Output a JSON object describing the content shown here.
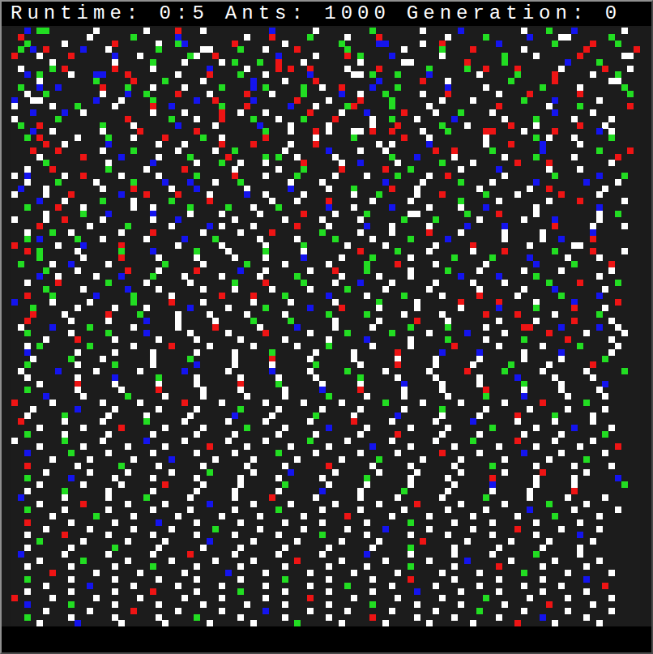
{
  "status_bar": {
    "runtime": "Runtime: 0:5",
    "ants": "Ants: 1000",
    "generation": "Generation: 0"
  },
  "grid": {
    "legend": {
      "w": "#ffffff",
      "r": "#ee1414",
      "g": "#22dd22",
      "b": "#1414ee"
    },
    "rows": [
      "..b.gg.......w.......w....r...w..........b......w........g.......w.....b.........w...g...b.......w..",
      ".r..........w......g......b..........w...r.....g.....w....r..........w.....g......b....ww......g....",
      "..g.....w.......r......w..gb.......r.......w........g.....bb.....w..r........b........g.....r...g...",
      ".g.b.r.....b...w.......g......ww....g...w....r.......g........w.....g....r.......w.........r.......r",
      "r...w....r......b...w.......gw..r.........b.....w....r.g....b.......w.........g....w......r......ww.",
      "......w.........w.....g....w.....w.g...g..r...w........w......ww........r.....g.........b....g......",
      ".w....g.r.......r.....w........b.....w....r.r..r.....w....r.......g.....g..r....r......w......r...w.",
      "..b.g....w...bb...r.......w....r....g...w......b......ww.g...g....b.......w.....g.....r.....w...g...",
      "....w........g.....r....g.....w.......b....w....r.........b......r...w.........g......r........ww...",
      ".g..b..b......r...g...w....w.....g....b.g.....g..w..r....b...g.......b.....w........g.....w......g..",
      "..w..g........w...b..g....r....w.....r...w....g.....b..w...g.....w...r.......w....r.......r.......g.",
      "b..ww........b...w....g......b..r.....b......r....w....r....g.......w....w.......g....b......w......",
      "w.....w...g.....w.....r..b.......g...r......b...w....gr.....g.....w..........r.......w....g.......r.",
      "...b....b..w..........w....w.....r..w...w......r....w...b.....r....w...g....w.........b.....w.......",
      "w......g..........r......g...w...r....g...w...g....r.....w..g...w.....b.......w....g.....w.....w....",
      ".g..r.........g....w......b.....w......b....w.....w......w...r......g...w......r...w......r...w.....",
      "...b..w.......w.....r........r..........g...w...r.w...ww.r..r....w...g.....rr....w....r......b.w....",
      "..g.r.....w....g...w....r.....g..w......r.......w.....g.......r...w........w.......g.w...w.....g....",
      ".....r..w......b.......w...w.....r....r.....w...r.........w.w.....b........w...r....b.....w.........",
      "...r...r......w....g......w.....w..g.......w......b....w...w.......r..r.....g.......b........g....r.",
      "....w......r.....b.....w....g.....r.....g.g..w.....w........g...b.....w.......w....g.....w......r...",
      ".....g.........w......b......w...g..w...w.....r.....w..b.....w......g....w......r....r.........w....",
      "..w...r........g.....w.....r.......w......w...g.....r......r...g.......w.....b.......w....w.........",
      "w.b.....w..r.....w.....w.....g.....r....w....g.....w....w....g....w..r........w.......g......b...g..",
      "..w....g.....w.....g....b...b...w...g.......w....w.........b.....w.....g....w......b.......b....w...",
      ".b...w........w....r.....w...b.......w......b.....w...g.....r...w.........w.......w..r........w.....",
      "w....w...r.......b...r....r....w.....b..w.....w.......w...g.....w...r......g....w......r.....w......",
      "....b...w.....g....w.....g.....r.........w...w....r......w.....w.......g.....w.......w....r......w..",
      "..g....r...w.......w..w.....g.....g...w...g.......b...w.....b.....w....w...b.......w.........b......",
      ".....w.....g...b......b.....w....w.....w......r....w....g......ww.......g....r.....w.........w..g...",
      "w....w..r.....w.......w...b........w.......w.....w.....w......g....g......w......w....b......w......",
      "....r.......w.....g......w.....b.w....w......r....w.....b...w.....w.....b.....b.......r.....w....w..",
      "..w...g..w.......w....r.......w.....w....r.......g.....w....w.....r....w......w.....w.......b.......",
      "..g.b.....g...w......w.....b....g......w.....w.....g.....w.....g.....b........w.....w..b....r.......",
      "r......w...b.....r........w......w......w.....g......w.....w.......w.....r........w......ww.........",
      "..r.g.....w......g....b......g....w.....g.....w........r.....g....w......w....r.......g.....r....w..",
      "....g......w.....r.....w.....w.....w....w.....b.....w....g.....w......g.....g.....b.....w....w......",
      ".g....w..b.....w........g.....w......g.....w......w.....g....r.....w.......w.......b.....g.....r....",
      ".....g....w.......r....w.....r......b...w......w...r....g......w.....g....w......w.....w.......w....",
      "....b..w.....w...b....g....w.....w.....w.....g......w.....w....w.......b.....b.....g.........w......",
      "..w....r.......g.....w......w......g....r.....g....w...b....w......w.....w....w......g....r.....g...",
      ".....g.....w......b....w......w....w.....w.....w.....g.....w......w.......w......w....b.......w.....",
      "..r...g......b.....g.....w.......r....r....g......b.....w.....g.....w.....r.....w......g.....b......",
      "b.....w.....w......g.....r....w.......w.....w......w......g.....w......r.....r.....w.....b......r...",
      "...g......w.....w....w......b.....w.....g......b....r.....w.....w......w.....b.....g.....r....w.....",
      "...r....w......r....g.....w....w.....w.....w......g.....g.....w.....w......r....r.....w......g......",
      "..r......w.....w.....b....w.....w.....g.....g......w......w.....r....w.......w.....w.....r.....w....",
      ".w....b.....g......w......w.....r......w.....b.....w.....w.....g.....g.....w.....rr....b.....b..w...",
      "..g......w.....g.....b......w.....w.....r......w.....g......g.....w.....b.....w......r.....w.....w..",
      ".....w....r.....w......w.....w......w......w......w.....b......w.....g.....w.....g......r......w....",
      "..w.g.......g......w.....r.....w......w......w....g......w.....w......r......w......w.....g.....w...",
      "..b.......w.....w.....w......w.....w.....g......w.....w......r......b.....b......w.....b.......w....",
      "...w.....g....w.......w.....g......w.....r.....w......w......w.....w......w......w.....w......g.....",
      "..g.......w.....g.....w......b.....w.....w......g......w.....r.....w.....w.....g.....w......r.......",
      ".w.....b.....w......w......b......w......b.....w.....g.....w......w.....r.....g.....w......w.....g..",
      "..w.......w.....b......g.....w......w.....w.....w......g.....w.....w......w.....b.....w.....w.......",
      "....w.....r.....w......w.....w......r.....g......w.....w......b.....w.....w......g.....w......b.....",
      "..g.......w......w.....r......w.....w......w.....b.....r......w.....w......r.....w.....w.....w......",
      ".....b.....w......g.....w.....w......w.....w......g.....w.....w......w.....g.....b......w.....w.....",
      "r.....w.......w.....w......r.....w......w.....w.....w......g.....w.....w......w.....r......g........",
      "...w......b.....w......w.....w......g.....w......w.....w......w.....g......w......w.....w.....w.....",
      "..w.....g......w.....w......w......b.....w......g.....w......b......w.....w.....r.....g.....w.......",
      ".r......w.....w......g.....w......w.....w......w......r.....w......w.....b......w.....w.....w.......",
      "....w......w.....r......w.....w......g.....w......b.....w......w.....w......g......w.....b.....w....",
      "..g.....w......w......w......w.....w......w.....w......w.....r......w.....w......w.....w......g.....",
      "w.......g.....w......b.....w......w.....w......g.....w......w......w.....g......r.....w.....w.......",
      "....w......w......w.....w......r.....w......w.....w......b.....w......w......w.....w......w.....r...",
      "..b......g.....w......w......w.....w......g.....w......w.....w......r.....w......b.....w......w.....",
      "......w.....w......w.....b......w.....w......w......w.....g......w.....w......w......w.....g........",
      "..r.......w......g.....w......w......w.....w......r......w.....w......w.....g......w.....w.....w....",
      ".....w......w.....w......w.....g......w.....b......w......w.....w......w......w.....r......w.......",
      "..g......b......w.....w......w......w.....w......w......g......w.....w......r......w.....w......b...",
      "....w......w.....w......r.....w.....w......g......w.....w......w......w.....b......w.....w.......g..",
      "..w.....g......w......w......w.....w......w......b.....w......g......w......w.....w......r.........",
      ".b......w......w.....g......w......w.....r......w......w.....w......w......g......w.....w.....w....",
      "....w......r......w.....w......b......w.....w......w......w.....r......w......w......g.....w.......",
      "..g.....w......w......w.....w......w......g......w.....w......w......w.....w......b......w......w..",
      "......w......g.....w......w......w.....w......w......r......w.....w......w......w.....g......w.....",
      "..r......w......w......b.....w......w......w.....w......w......g......w.....w......w......w........",
      ".....w......w......w.....w......g......w......w......w.....b......w......w......r......w.....w.....",
      "..w.....r......w......w......w.....w......w......g......w......w.....w......w......w......b........",
      "....g......w......w.....w......b......w......w......w.....w......r......w......w.....w......w......",
      "..w......w......g......w......w.....w......w......w......w.....g......w......w......w.....w........",
      ".b......w......w......w.....r......w......w......w......b......w......w.....w......g......w........",
      "....w......g......w......w......w.....w......r......w......w......w.....b......w......w......w.....",
      "..w......w......w.....g......w......w......w......w.....w......g......w......r......w......w.......",
      "......r......w......w......w......b.....w......w......w......w......w.....w......g......w......w...",
      "..g......w......w......w.....w......w......g......w......w.....r......w......w......w......b.......",
      ".....w......b......w......w......w......w......w.....g......w......w......w......w.....w......r....",
      "..w......w......w.....r......w......g......w......w......w......b......w.....w......w......w.......",
      "r.....w......w......w......w.....w......w......r......w......w......w......g......w.....w......w...",
      "..b......g......w......w......w......w.....w......w......g......w......w......w......r......w......",
      ".....w......w......r......w......w......b......w.....w......w......w......g......w......w......w..",
      "..g......w......w......w.....g......w......w......w......r......w.....w......w......b......w.......",
      "....w.....b......w......w......w......w......g......w......w......w......w......r.....w......w....."
    ]
  }
}
